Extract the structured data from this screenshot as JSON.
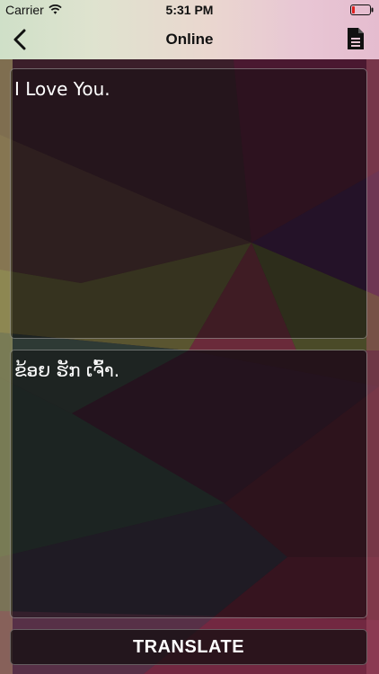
{
  "status_bar": {
    "carrier": "Carrier",
    "time": "5:31 PM",
    "wifi_icon": "wifi-icon",
    "battery_icon": "battery-low-icon",
    "battery_color": "#e0201e"
  },
  "nav": {
    "title": "Online",
    "back_icon": "chevron-left-icon",
    "document_icon": "document-icon"
  },
  "source": {
    "text": "I Love You."
  },
  "target": {
    "text": "ຂ້ອຍ ຮັກ ເຈົ້າ."
  },
  "translate_button": {
    "label": "TRANSLATE"
  },
  "colors": {
    "header_text": "#111111",
    "panel_text": "#ffffff"
  }
}
